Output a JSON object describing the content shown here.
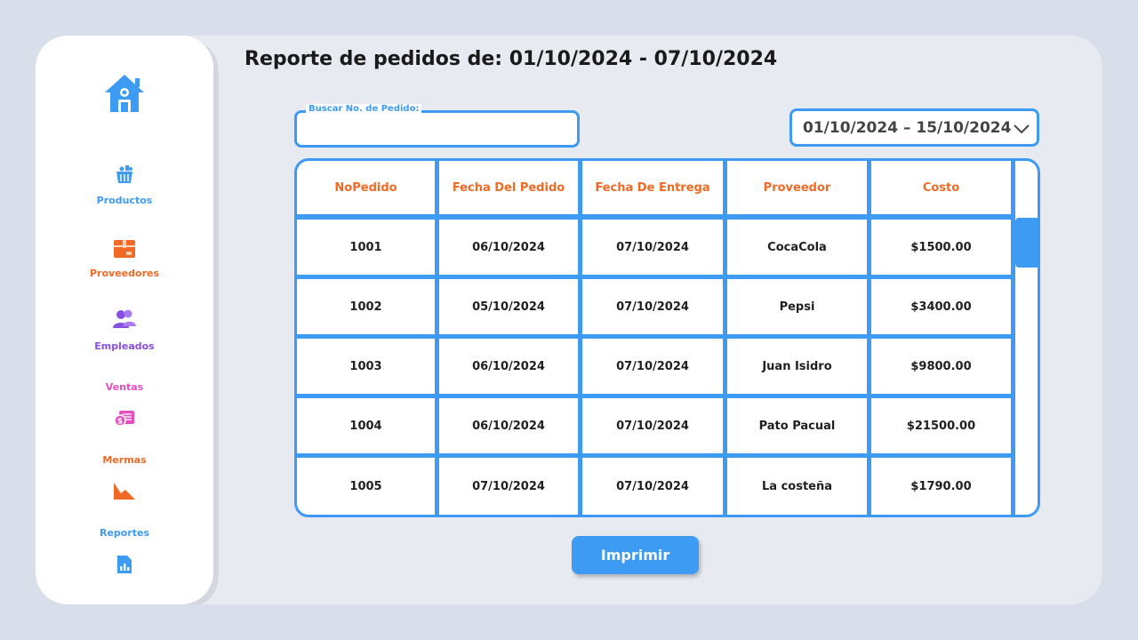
{
  "header": {
    "title": "Reporte de pedidos de: 01/10/2024 - 07/10/2024"
  },
  "sidebar": {
    "items": [
      {
        "label": "Productos",
        "icon": "basket-icon",
        "color": "#3e9bf3"
      },
      {
        "label": "Proveedores",
        "icon": "box-icon",
        "color": "#f06a25"
      },
      {
        "label": "Empleados",
        "icon": "users-icon",
        "color": "#8a4fe0"
      },
      {
        "label": "Ventas",
        "icon": "money-icon",
        "color": "#e64fc0"
      },
      {
        "label": "Mermas",
        "icon": "decline-chart-icon",
        "color": "#f06a25"
      },
      {
        "label": "Reportes",
        "icon": "report-icon",
        "color": "#3e9bf3"
      }
    ]
  },
  "search": {
    "label": "Buscar No. de Pedido:",
    "value": "",
    "placeholder": ""
  },
  "date_range": {
    "selected": "01/10/2024 – 15/10/2024"
  },
  "table": {
    "headers": [
      "NoPedido",
      "Fecha Del Pedido",
      "Fecha De Entrega",
      "Proveedor",
      "Costo"
    ],
    "rows": [
      [
        "1001",
        "06/10/2024",
        "07/10/2024",
        "CocaCola",
        "$1500.00"
      ],
      [
        "1002",
        "05/10/2024",
        "07/10/2024",
        "Pepsi",
        "$3400.00"
      ],
      [
        "1003",
        "06/10/2024",
        "07/10/2024",
        "Juan Isidro",
        "$9800.00"
      ],
      [
        "1004",
        "06/10/2024",
        "07/10/2024",
        "Pato Pacual",
        "$21500.00"
      ],
      [
        "1005",
        "07/10/2024",
        "07/10/2024",
        "La costeña",
        "$1790.00"
      ]
    ]
  },
  "actions": {
    "print_label": "Imprimir"
  },
  "colors": {
    "accent": "#3e9bf3",
    "header_text": "#f06a25",
    "background": "#d8deea"
  }
}
